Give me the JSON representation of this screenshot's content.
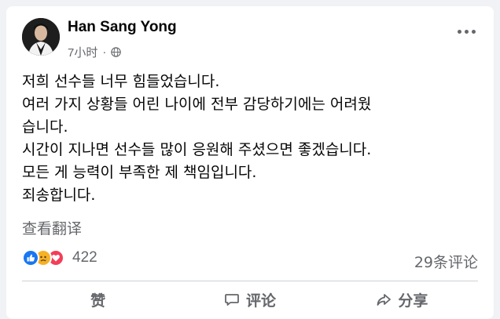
{
  "post": {
    "author": "Han Sang Yong",
    "time": "7小时",
    "separator": "·",
    "visibility_icon": "globe-icon",
    "lines": [
      "저희 선수들 너무 힘들었습니다.",
      "여러 가지 상황들 어린 나이에 전부 감당하기에는 어려웠",
      "습니다.",
      "시간이 지나면 선수들 많이 응원해 주셨으면 좋겠습니다.",
      "모든 게 능력이 부족한 제 책임입니다.",
      "죄송합니다."
    ],
    "translate_label": "查看翻译"
  },
  "stats": {
    "reaction_icons": [
      "like-icon",
      "sad-icon",
      "love-icon"
    ],
    "reaction_count": "422",
    "comments_count": "29条评论"
  },
  "actions": {
    "like_label": "赞",
    "comment_label": "评论",
    "share_label": "分享"
  },
  "colors": {
    "like_blue": "#1877f2",
    "sad_yellow": "#f7b125",
    "love_red": "#f33e58",
    "secondary_text": "#65676b"
  }
}
